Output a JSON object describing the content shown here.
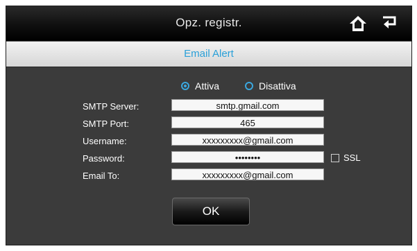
{
  "header": {
    "title": "Opz. registr.",
    "home_icon": "home-icon",
    "back_icon": "return-icon"
  },
  "section": {
    "title": "Email Alert"
  },
  "mode": {
    "options": [
      "Attiva",
      "Disattiva"
    ],
    "selected": "Attiva"
  },
  "form": {
    "smtp_server": {
      "label": "SMTP Server:",
      "value": "smtp.gmail.com"
    },
    "smtp_port": {
      "label": "SMTP Port:",
      "value": "465"
    },
    "username": {
      "label": "Username:",
      "value": "xxxxxxxxx@gmail.com"
    },
    "password": {
      "label": "Password:",
      "value": "••••••••"
    },
    "ssl": {
      "label": "SSL",
      "checked": false
    },
    "email_to": {
      "label": "Email To:",
      "value": "xxxxxxxxx@gmail.com"
    }
  },
  "actions": {
    "ok_label": "OK"
  },
  "colors": {
    "accent": "#3aa8e0",
    "panel_background": "#3b3b3b",
    "titlebar": "#000000"
  }
}
